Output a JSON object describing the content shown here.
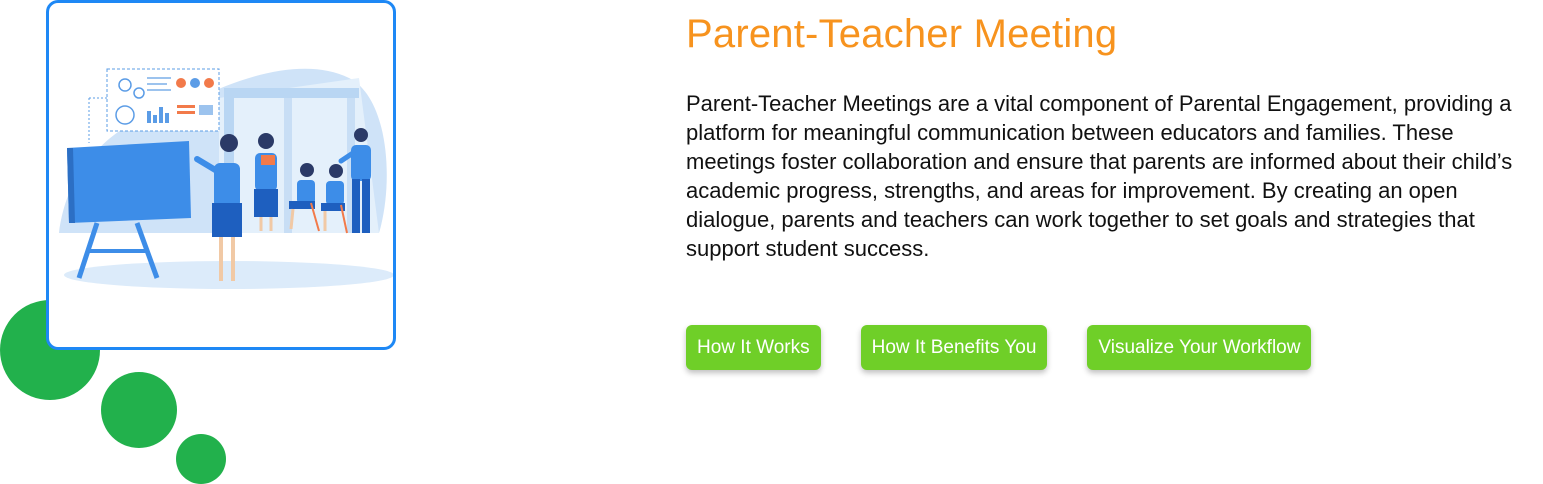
{
  "header": {
    "title": "Parent-Teacher Meeting"
  },
  "main": {
    "description": "Parent-Teacher Meetings are a vital component of Parental Engagement, providing a platform for meaningful communication between educators and families. These meetings foster collaboration and ensure that parents are informed about their child’s academic progress, strengths, and areas for improvement. By creating an open dialogue, parents and teachers can work together to set goals and strategies that support student success.",
    "buttons": [
      {
        "label": "How It Works"
      },
      {
        "label": "How It Benefits You"
      },
      {
        "label": "Visualize Your Workflow"
      }
    ]
  },
  "illustration": {
    "icon": "parent-teacher-meeting-illustration",
    "border_color": "#1e88f5"
  },
  "colors": {
    "title": "#f7931e",
    "button_bg": "#6fcf28",
    "decor_circles": "#22b14c"
  }
}
